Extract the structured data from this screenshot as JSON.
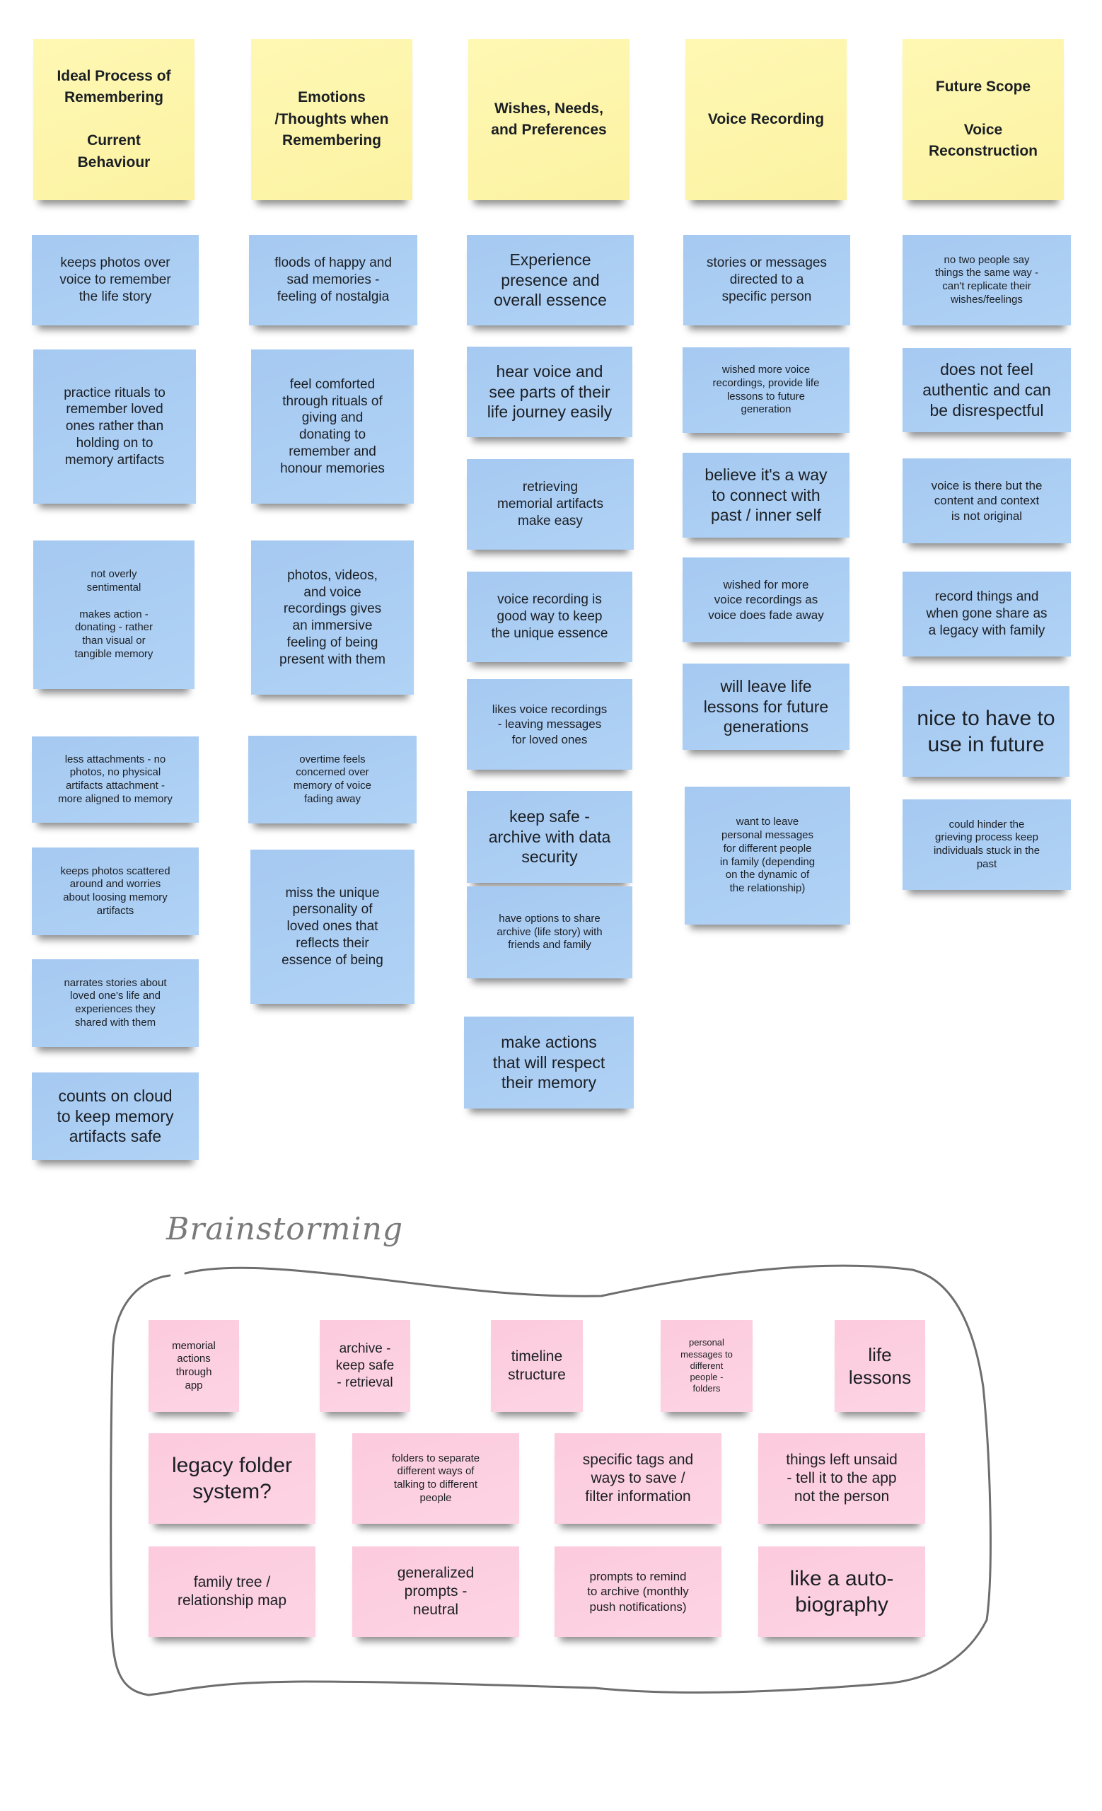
{
  "board": {
    "columns": [
      {
        "header": "Ideal Process of\nRemembering\n\nCurrent\nBehaviour",
        "notes": [
          "keeps photos over\nvoice to remember\nthe life story",
          "practice rituals to\nremember loved\nones rather than\nholding on to\nmemory artifacts",
          "not overly\nsentimental\n\nmakes action -\ndonating - rather\nthan visual or\ntangible memory",
          "less attachments - no\nphotos, no physical\nartifacts attachment -\nmore aligned to memory",
          "keeps photos scattered\naround and worries\nabout loosing  memory\nartifacts",
          "narrates stories about\nloved one's life and\nexperiences they\nshared with them",
          "counts on cloud\nto keep memory\nartifacts safe"
        ]
      },
      {
        "header": "Emotions\n/Thoughts when\nRemembering",
        "notes": [
          "floods of happy and\nsad memories -\nfeeling of nostalgia",
          "feel comforted\nthrough rituals of\ngiving and\ndonating to\nremember and\nhonour memories",
          "photos, videos,\nand voice\nrecordings gives\nan immersive\nfeeling of being\npresent with them",
          "overtime feels\nconcerned over\nmemory of voice\nfading away",
          "miss the unique\npersonality of\nloved ones that\nreflects their\nessence of being"
        ]
      },
      {
        "header": "Wishes, Needs,\nand Preferences",
        "notes": [
          "Experience\npresence and\noverall essence",
          "hear voice and\nsee parts of their\nlife journey easily",
          "retrieving\nmemorial artifacts\nmake easy",
          "voice recording is\ngood way to keep\nthe unique essence",
          "likes voice recordings\n- leaving messages\nfor loved ones",
          "keep safe -\narchive with data\nsecurity",
          "have options to share\narchive (life story) with\nfriends and family",
          "make actions\nthat will respect\ntheir memory"
        ]
      },
      {
        "header": "Voice Recording",
        "notes": [
          "stories or messages\ndirected to a\nspecific person",
          "wished more voice\nrecordings, provide life\nlessons to future\ngeneration",
          "believe it's a way\nto connect with\npast / inner self",
          "wished for more\nvoice recordings as\nvoice does fade away",
          "will leave life\nlessons for future\ngenerations",
          "want to leave\npersonal messages\nfor different people\nin family (depending\non the dynamic of\nthe relationship)"
        ]
      },
      {
        "header": "Future Scope\n\nVoice\nReconstruction",
        "notes": [
          "no two people say\nthings the same way -\ncan't replicate their\nwishes/feelings",
          "does not feel\nauthentic and can\nbe disrespectful",
          "voice is there but the\ncontent and context\nis not original",
          "record things and\nwhen gone share as\na legacy with family",
          "nice to have to\nuse in future",
          "could hinder the\ngrieving process keep\nindividuals stuck in the\npast"
        ]
      }
    ]
  },
  "brainstorming": {
    "title": "Brainstorming",
    "notes": [
      "memorial\nactions\nthrough\napp",
      "archive -\nkeep safe\n- retrieval",
      "timeline\nstructure",
      "personal\nmessages to\ndifferent\npeople -\nfolders",
      "life\nlessons",
      "legacy folder\nsystem?",
      "folders to separate\ndifferent ways of\ntalking to different\npeople",
      "specific tags and\nways to save /\nfilter information",
      "things left unsaid\n- tell it to the app\nnot the person",
      "family tree /\nrelationship map",
      "generalized\nprompts -\nneutral",
      "prompts to remind\nto archive (monthly\npush notifications)",
      "like a auto-\nbiography"
    ]
  },
  "colors": {
    "header_note": "#fdf6a9",
    "insight_note": "#a8cbf2",
    "brainstorm_note": "#fccfe0",
    "outline": "#6e6e6e",
    "title": "#7a7a7a"
  }
}
